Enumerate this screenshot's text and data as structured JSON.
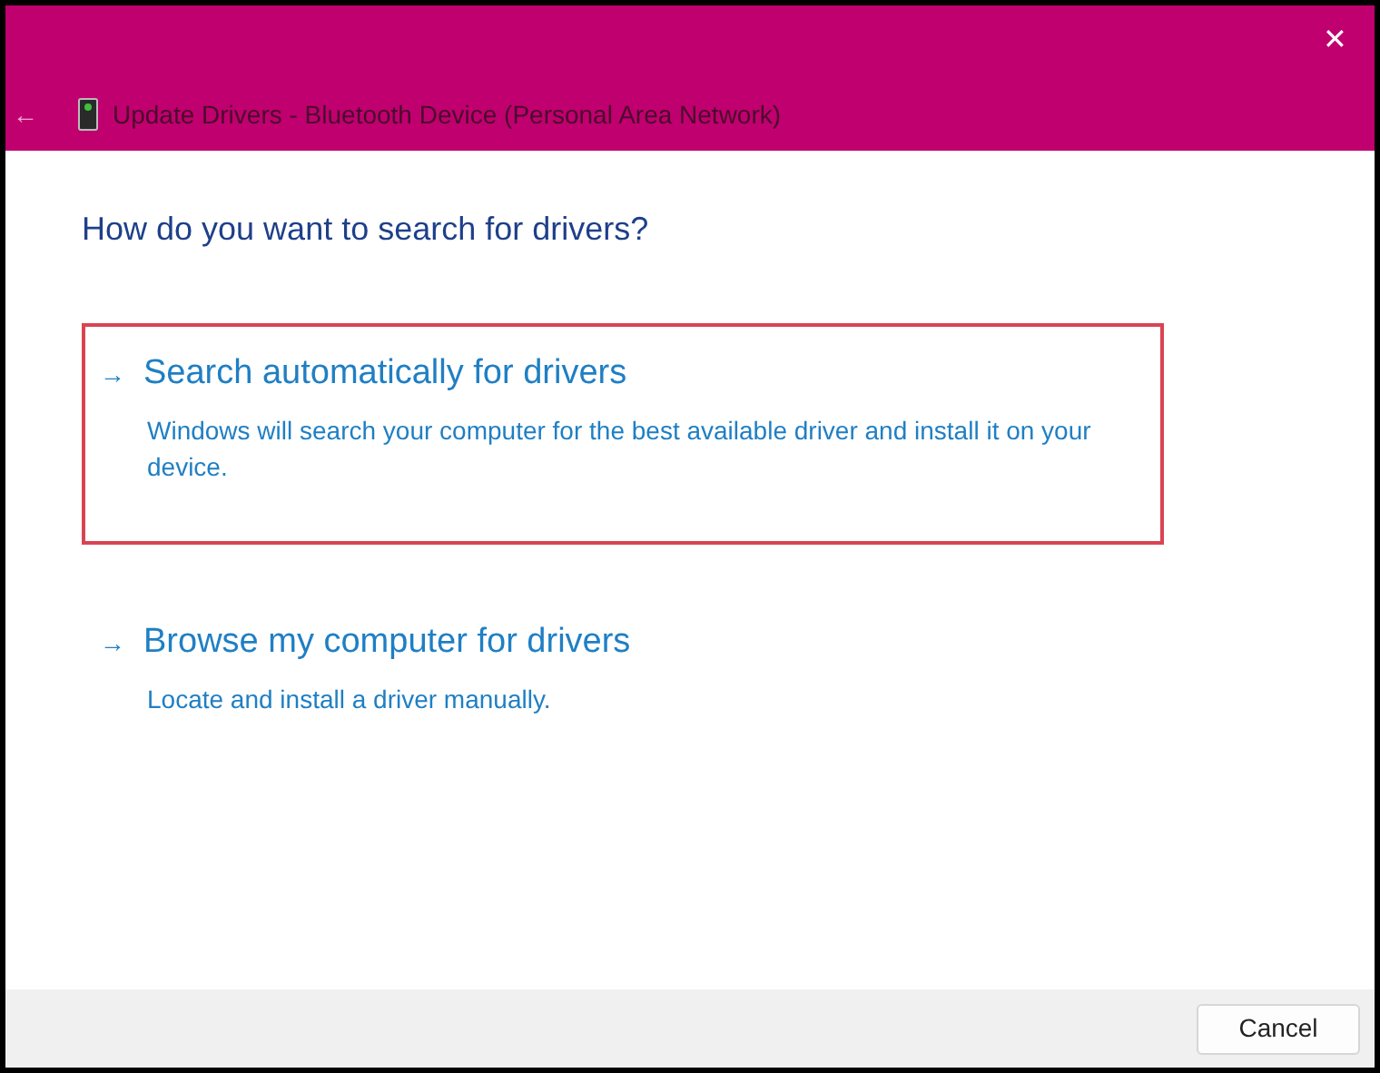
{
  "window": {
    "close_glyph": "✕",
    "back_glyph": "←",
    "title": "Update Drivers - Bluetooth Device (Personal Area Network)"
  },
  "heading": "How do you want to search for drivers?",
  "options": [
    {
      "arrow": "→",
      "title": "Search automatically for drivers",
      "description": "Windows will search your computer for the best available driver and install it on your device.",
      "highlighted": true
    },
    {
      "arrow": "→",
      "title": "Browse my computer for drivers",
      "description": "Locate and install a driver manually.",
      "highlighted": false
    }
  ],
  "buttons": [
    "Cancel"
  ]
}
